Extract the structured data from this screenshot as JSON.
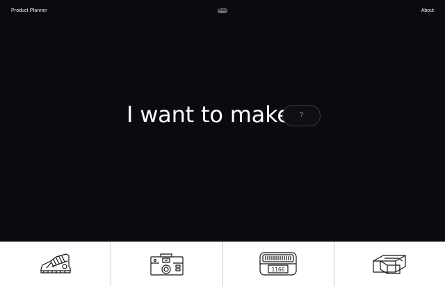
{
  "header": {
    "brand": "Product Planner",
    "beta_label": "Beta",
    "about_label": "About"
  },
  "hero": {
    "text": "I want to make",
    "pill_placeholder": "?"
  },
  "cards": [
    {
      "icon": "sneaker-icon"
    },
    {
      "icon": "camera-icon"
    },
    {
      "icon": "price-display-icon"
    },
    {
      "icon": "box-icon"
    }
  ],
  "colors": {
    "background": "#0a0b0e",
    "cards_background": "#ffffff",
    "pill_border": "#3a3c45"
  }
}
